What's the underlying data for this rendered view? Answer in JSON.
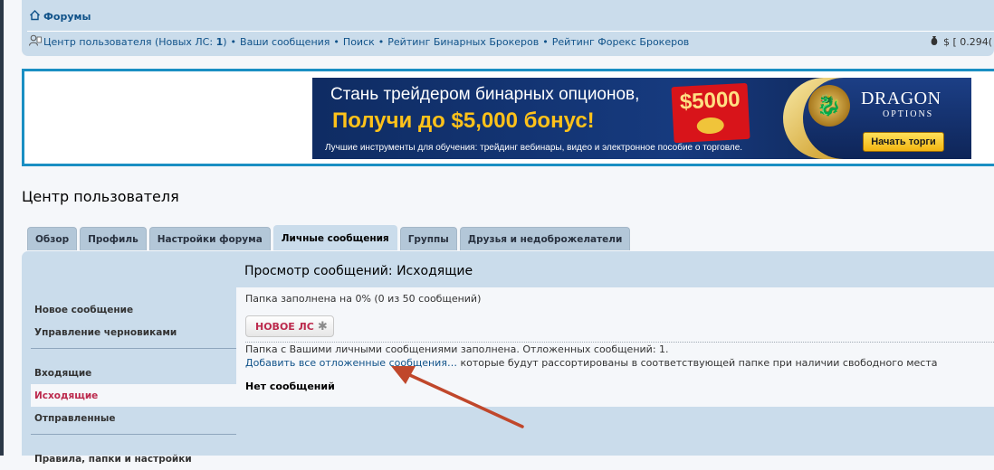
{
  "nav": {
    "home": "Форумы",
    "links": [
      "Центр пользователя (Новых ЛС: ",
      "1",
      ")",
      "Ваши сообщения",
      "Поиск",
      "Рейтинг Бинарных Брокеров",
      "Рейтинг Форекс Брокеров"
    ],
    "balance": "$ [ 0.294("
  },
  "banner": {
    "line1": "Стань трейдером бинарных опционов,",
    "line2": "Получи до $5,000 бонус!",
    "line3": "Лучшие инструменты для обучения: трейдинг вебинары, видео и электронное пособие о торговле.",
    "prize": "$5000",
    "brand": "DRAGON",
    "brand_sub": "OPTIONS",
    "cta": "Начать торги"
  },
  "page_title": "Центр пользователя",
  "tabs": [
    "Обзор",
    "Профиль",
    "Настройки форума",
    "Личные сообщения",
    "Группы",
    "Друзья и недоброжелатели"
  ],
  "active_tab": "Личные сообщения",
  "menu": {
    "group1": [
      "Новое сообщение",
      "Управление черновиками"
    ],
    "group2": [
      "Входящие",
      "Исходящие",
      "Отправленные"
    ],
    "group3": [
      "Правила, папки и настройки"
    ],
    "active": "Исходящие"
  },
  "content": {
    "title": "Просмотр сообщений: Исходящие",
    "quota": "Папка заполнена на 0% (0 из 50 сообщений)",
    "new_pm": "НОВОЕ ЛС",
    "note1": "Папка с Вашими личными сообщениями заполнена. Отложенных сообщений: 1.",
    "note2_link": "Добавить все отложенные сообщения…",
    "note2_rest": " которые будут рассортированы в соответствующей папке при наличии свободного места",
    "empty": "Нет сообщений"
  },
  "colors": {
    "nav_bg": "#cadceb",
    "link": "#105289",
    "active_red": "#bc2a4d",
    "banner_border": "#1a8fc3",
    "annotation_arrow": "#c0472b"
  }
}
